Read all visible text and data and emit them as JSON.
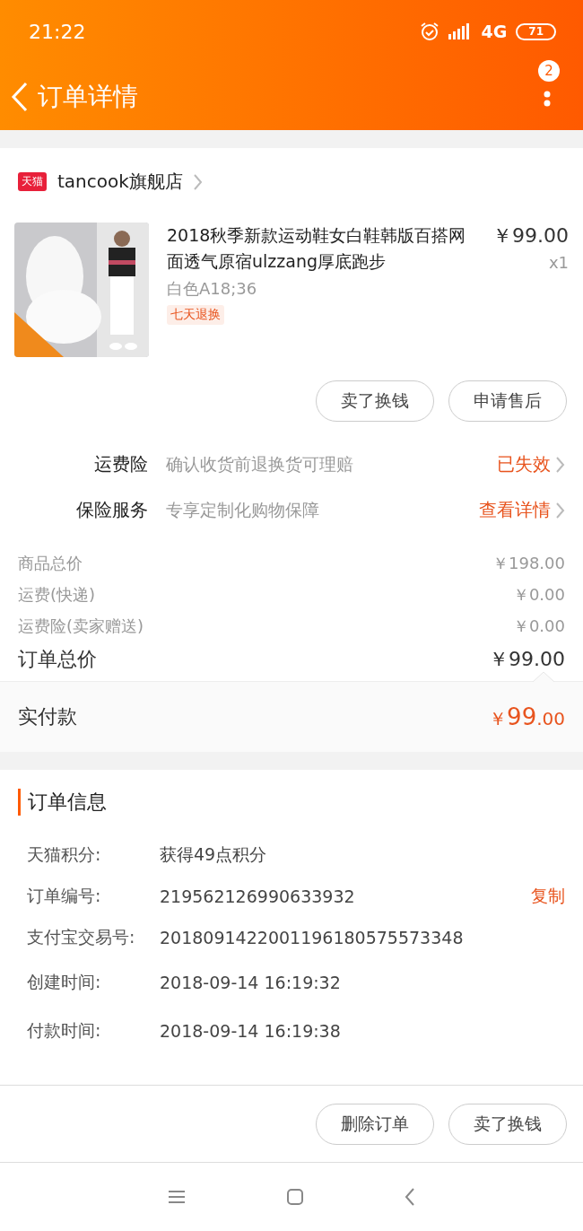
{
  "status_bar": {
    "time": "21:22",
    "network": "4G",
    "battery": "71"
  },
  "header": {
    "title": "订单详情",
    "badge": "2"
  },
  "shop": {
    "name": "tancook旗舰店",
    "tag": "天猫"
  },
  "product": {
    "kind": "picture",
    "title": "2018秋季新款运动鞋女白鞋韩版百搭网面透气原宿ulzzang厚底跑步",
    "sku": "白色A18;36",
    "tag": "七天退换",
    "price": "￥99.00",
    "quantity": "x1"
  },
  "item_buttons": [
    "卖了换钱",
    "申请售后"
  ],
  "services": [
    {
      "label": "运费险",
      "desc": "确认收货前退换货可理赔",
      "status": "已失效"
    },
    {
      "label": "保险服务",
      "desc": "专享定制化购物保障",
      "status": "查看详情"
    }
  ],
  "price_lines": [
    {
      "label": "商品总价",
      "value": "￥198.00",
      "kind": "minor"
    },
    {
      "label": "运费(快递)",
      "value": "￥0.00",
      "kind": "minor"
    },
    {
      "label": "运费险(卖家赠送)",
      "value": "￥0.00",
      "kind": "minor"
    },
    {
      "label": "订单总价",
      "value": "￥99.00",
      "kind": "total"
    }
  ],
  "paid": {
    "label": "实付款",
    "value_parts": [
      "￥",
      "99",
      ".00"
    ]
  },
  "order_info": {
    "title": "订单信息",
    "rows": [
      {
        "label": "天猫积分:",
        "value": "获得49点积分"
      },
      {
        "label": "订单编号:",
        "value": "219562126990633932",
        "action": "复制"
      },
      {
        "label": "支付宝交易号:",
        "value": "2018091422001196180575573348"
      },
      {
        "label": "创建时间:",
        "value": "2018-09-14 16:19:32"
      },
      {
        "label": "付款时间:",
        "value": "2018-09-14 16:19:38"
      }
    ]
  },
  "bottom_buttons": [
    "删除订单",
    "卖了换钱"
  ]
}
